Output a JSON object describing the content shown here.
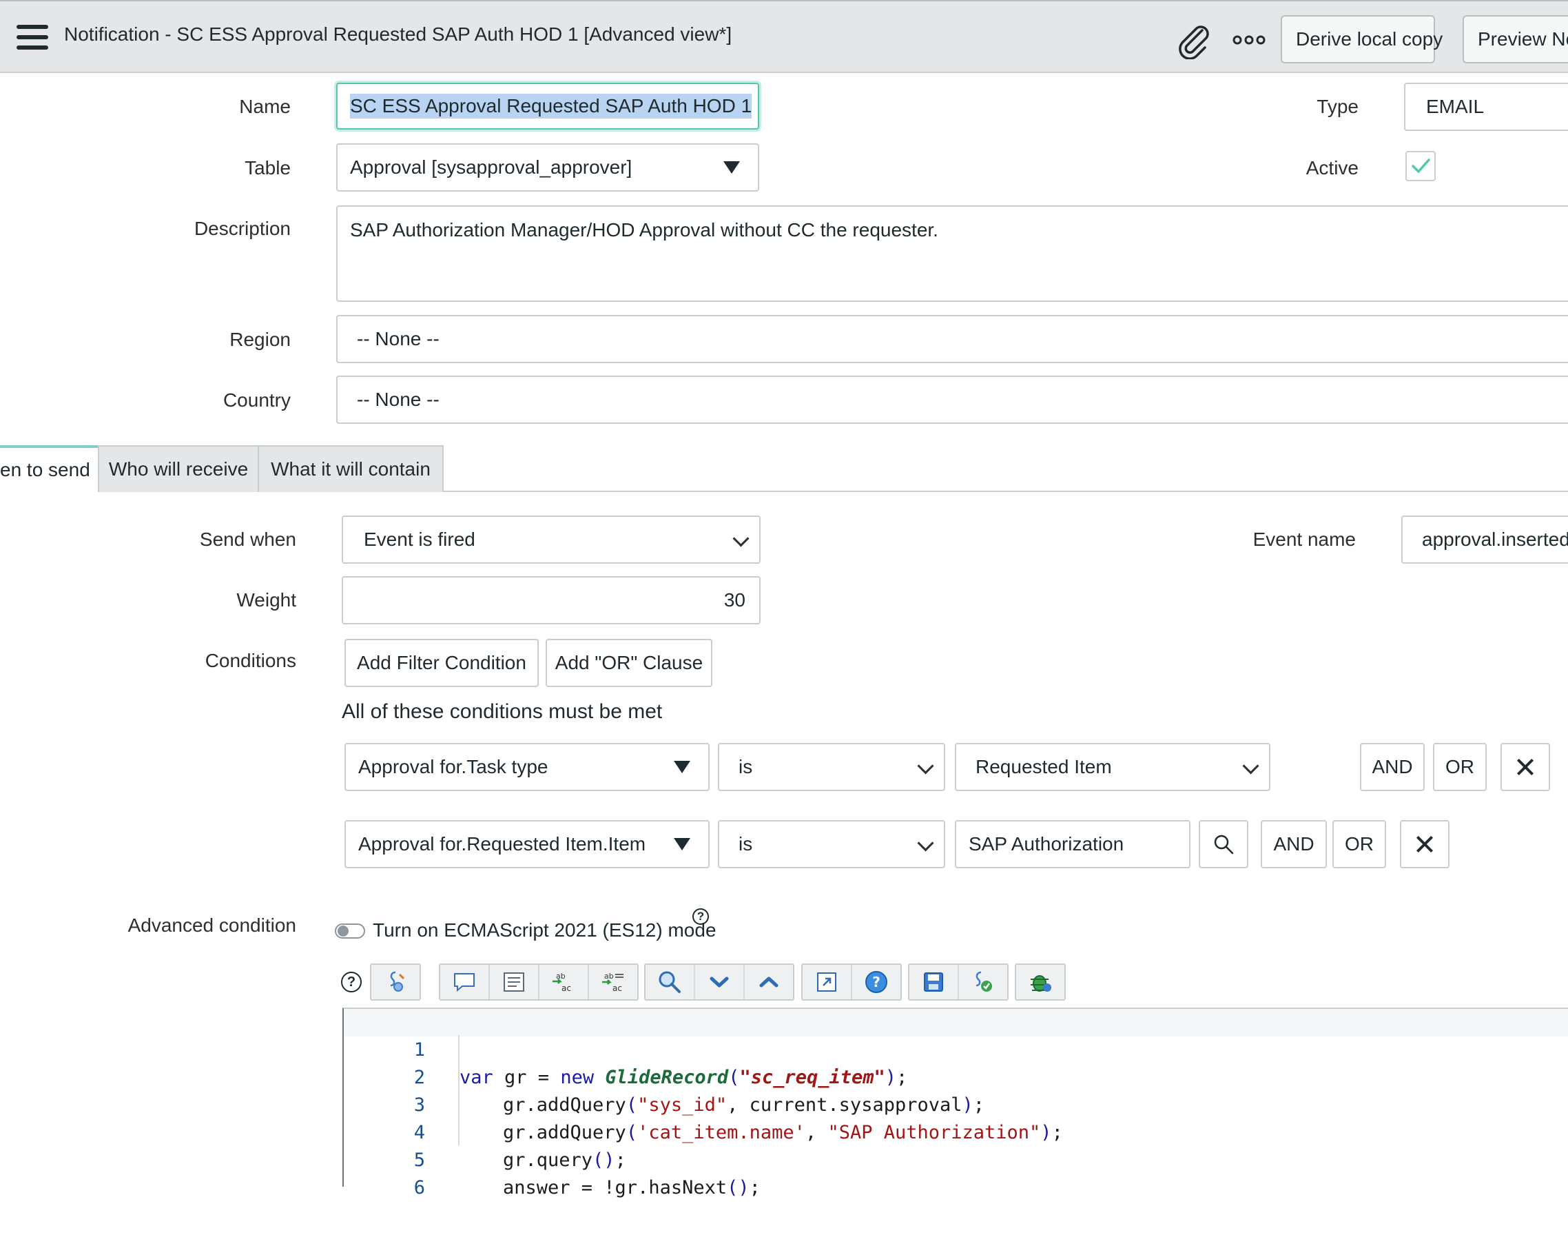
{
  "header": {
    "title": "Notification - SC ESS Approval Requested SAP Auth HOD 1 [Advanced view*]",
    "buttons": {
      "derive": "Derive local copy",
      "preview": "Preview No"
    }
  },
  "form": {
    "name_label": "Name",
    "name_value": "SC ESS Approval Requested SAP Auth HOD 1",
    "type_label": "Type",
    "type_value": "EMAIL",
    "table_label": "Table",
    "table_value": "Approval [sysapproval_approver]",
    "active_label": "Active",
    "active_checked": true,
    "description_label": "Description",
    "description_value": "SAP Authorization Manager/HOD Approval without CC the requester.",
    "region_label": "Region",
    "region_value": "-- None --",
    "country_label": "Country",
    "country_value": "-- None --"
  },
  "tabs": [
    {
      "label": "en to send",
      "active": true
    },
    {
      "label": "Who will receive",
      "active": false
    },
    {
      "label": "What it will contain",
      "active": false
    }
  ],
  "when": {
    "send_when_label": "Send when",
    "send_when_value": "Event is fired",
    "event_name_label": "Event name",
    "event_name_value": "approval.inserted",
    "weight_label": "Weight",
    "weight_value": "30",
    "conditions_label": "Conditions",
    "add_filter_label": "Add Filter Condition",
    "add_or_label": "Add \"OR\" Clause",
    "all_met_text": "All of these conditions must be met",
    "conditions": [
      {
        "field": "Approval for.Task type",
        "operator": "is",
        "value": "Requested Item",
        "and": "AND",
        "or": "OR"
      },
      {
        "field": "Approval for.Requested Item.Item",
        "operator": "is",
        "value": "SAP Authorization",
        "and": "AND",
        "or": "OR"
      }
    ],
    "advanced_label": "Advanced condition",
    "es12_toggle_label": "Turn on ECMAScript 2021 (ES12) mode",
    "help_glyph": "?"
  },
  "toolbar_icons": [
    "help-icon",
    "script-include-icon",
    "comment-icon",
    "format-icon",
    "replace-icon",
    "replace-all-icon",
    "search-icon",
    "next-icon",
    "previous-icon",
    "fullscreen-icon",
    "help-circle-icon",
    "save-icon",
    "syntax-check-icon",
    "debug-icon"
  ],
  "code": {
    "line_numbers": [
      "1",
      "2",
      "3",
      "4",
      "5",
      "6"
    ],
    "lines": [
      "var gr = new GlideRecord(\"sc_req_item\");",
      "gr.addQuery(\"sys_id\", current.sysapproval);",
      "gr.addQuery('cat_item.name', \"SAP Authorization\");",
      "gr.query();",
      "answer = !gr.hasNext();",
      ""
    ]
  },
  "colors": {
    "accent": "#55c7ad",
    "header_bg": "#e4e6e7",
    "tab_accent": "#81d1c0",
    "selection": "#b8d4f2"
  }
}
